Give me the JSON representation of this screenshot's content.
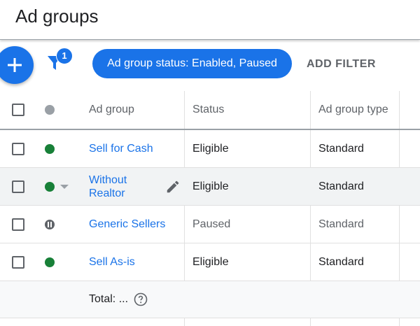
{
  "page": {
    "title": "Ad groups"
  },
  "toolbar": {
    "filter_count": "1",
    "filter_chip": "Ad group status: Enabled, Paused",
    "add_filter": "ADD FILTER"
  },
  "table": {
    "columns": [
      "Ad group",
      "Status",
      "Ad group type"
    ],
    "rows": [
      {
        "name": "Sell for Cash",
        "name_line2": "",
        "status": "Eligible",
        "type": "Standard",
        "state": "enabled"
      },
      {
        "name": "Without",
        "name_line2": "Realtor",
        "status": "Eligible",
        "type": "Standard",
        "state": "enabled"
      },
      {
        "name": "Generic Sellers",
        "name_line2": "",
        "status": "Paused",
        "type": "Standard",
        "state": "paused"
      },
      {
        "name": "Sell As-is",
        "name_line2": "",
        "status": "Eligible",
        "type": "Standard",
        "state": "enabled"
      }
    ],
    "total_label": "Total: ..."
  },
  "icons": {
    "fab": "plus-icon",
    "filter": "filter-funnel-icon",
    "edit": "pencil-icon",
    "help": "help-circle-icon"
  },
  "colors": {
    "accent": "#1a73e8",
    "enabled": "#188038",
    "paused": "#5f6368"
  }
}
